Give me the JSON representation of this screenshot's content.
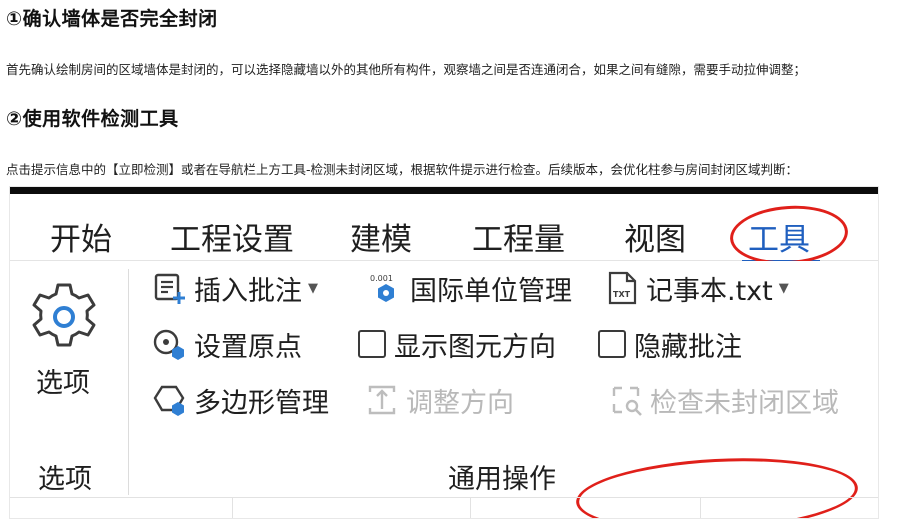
{
  "article": {
    "heading1": "①确认墙体是否完全封闭",
    "para1": "首先确认绘制房间的区域墙体是封闭的，可以选择隐藏墙以外的其他所有构件，观察墙之间是否连通闭合，如果之间有缝隙，需要手动拉伸调整；",
    "heading2": "②使用软件检测工具",
    "para2": "点击提示信息中的【立即检测】或者在导航栏上方工具-检测未封闭区域，根据软件提示进行检查。后续版本，会优化柱参与房间封闭区域判断："
  },
  "tabs": [
    {
      "label": "开始"
    },
    {
      "label": "工程设置"
    },
    {
      "label": "建模"
    },
    {
      "label": "工程量"
    },
    {
      "label": "视图"
    },
    {
      "label": "工具"
    }
  ],
  "ribbon": {
    "options_label": "选项",
    "options_group_label": "选项",
    "insert_note": "插入批注",
    "unit_manage": "国际单位管理",
    "unit_badge": "0.001",
    "notepad": "记事本.txt",
    "notepad_badge": "TXT",
    "set_origin": "设置原点",
    "show_direction": "显示图元方向",
    "hide_notes": "隐藏批注",
    "polygon_manage": "多边形管理",
    "adjust_direction": "调整方向",
    "check_unclosed": "检查未封闭区域",
    "general_group_label": "通用操作"
  },
  "colors": {
    "active_tab": "#1f5fbf",
    "annotation_red": "#e0201a",
    "disabled_text": "#b9b9b9",
    "icon_blue": "#2f7fd3"
  }
}
